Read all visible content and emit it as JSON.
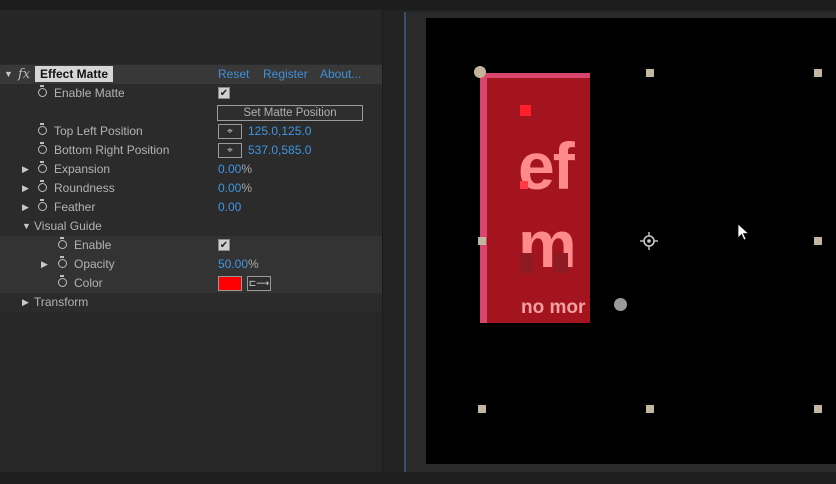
{
  "effect": {
    "name": "Effect Matte",
    "links": {
      "reset": "Reset",
      "register": "Register",
      "about": "About..."
    },
    "fx_label": "fx"
  },
  "properties": {
    "enable_matte": {
      "label": "Enable Matte",
      "checked": true
    },
    "set_matte_button": "Set Matte Position",
    "top_left": {
      "label": "Top Left Position",
      "value": "125.0,125.0"
    },
    "bottom_right": {
      "label": "Bottom Right Position",
      "value": "537.0,585.0"
    },
    "expansion": {
      "label": "Expansion",
      "value": "0.00",
      "unit": "%"
    },
    "roundness": {
      "label": "Roundness",
      "value": "0.00",
      "unit": "%"
    },
    "feather": {
      "label": "Feather",
      "value": "0.00"
    },
    "visual_guide": {
      "label": "Visual Guide",
      "enable": {
        "label": "Enable",
        "checked": true
      },
      "opacity": {
        "label": "Opacity",
        "value": "50.00",
        "unit": "%"
      },
      "color": {
        "label": "Color",
        "hex": "#ff0000"
      }
    },
    "transform": {
      "label": "Transform"
    }
  },
  "viewer": {
    "layer_text": {
      "line1": "ef",
      "line2": "m",
      "line3": "no mor"
    },
    "colors": {
      "matte_fill": "#a3141e",
      "matte_edge": "#d9456c",
      "text": "#ff8a8a",
      "background": "#000000"
    }
  },
  "icons": [
    "fx-icon",
    "stopwatch-icon",
    "twirl-arrow-icon",
    "crosshair-icon",
    "eyedropper-icon",
    "anchor-point-icon",
    "mouse-cursor-icon"
  ]
}
